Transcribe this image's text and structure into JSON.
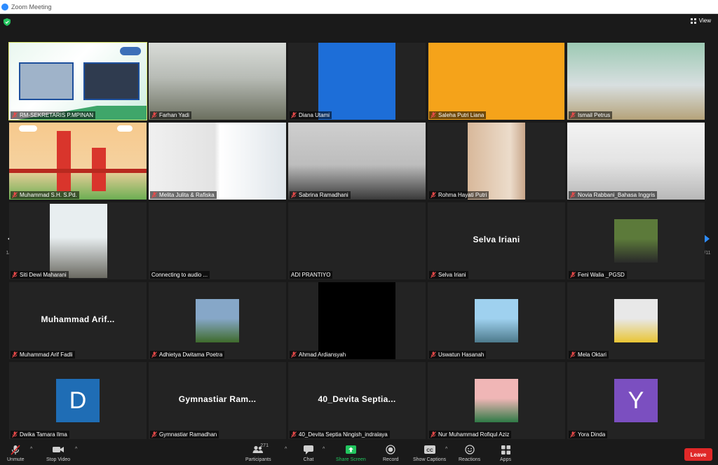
{
  "window": {
    "title": "Zoom Meeting"
  },
  "header": {
    "view_label": "View"
  },
  "pagination": {
    "left": "1/11",
    "right": "1/11"
  },
  "colors": {
    "active_speaker": "#d7e36a",
    "leave": "#e02828",
    "share": "#22c55e",
    "arrow": "#2d8cff"
  },
  "participants": [
    {
      "name": "RM-SEKRETARIS P.MPINAN",
      "display": "video",
      "icon": "shared-screen"
    },
    {
      "name": "Farhan Yadi",
      "display": "video"
    },
    {
      "name": "Diana Utami",
      "display": "video"
    },
    {
      "name": "Saleha Putri Liana",
      "display": "video"
    },
    {
      "name": "Ismail Petrus",
      "display": "video"
    },
    {
      "name": "Muhammad S.H. S.Pd.",
      "display": "video",
      "icon": "bridge-illustration"
    },
    {
      "name": "Melita Julita & Rafiska",
      "display": "video"
    },
    {
      "name": "Sabrina Ramadhani",
      "display": "video"
    },
    {
      "name": "Rohma Hayati Putri",
      "display": "video"
    },
    {
      "name": "Novia Rabbani_Bahasa Inggris",
      "display": "video"
    },
    {
      "name": "Siti Dewi Maharani",
      "display": "photo"
    },
    {
      "name": "Connecting to audio ...",
      "display": "blank"
    },
    {
      "name": "ADI PRANTIYO",
      "display": "blank"
    },
    {
      "name": "Selva Iriani",
      "display": "name",
      "big": "Selva Iriani"
    },
    {
      "name": "Feni Walia _PGSD",
      "display": "photo"
    },
    {
      "name": "Muhammad Arif Fadli",
      "display": "name",
      "big": "Muhammad  Arif..."
    },
    {
      "name": "Adhietya Dwitama Poetra",
      "display": "photo"
    },
    {
      "name": "Ahmad Ardiansyah",
      "display": "black"
    },
    {
      "name": "Uswatun Hasanah",
      "display": "photo"
    },
    {
      "name": "Mela Oktari",
      "display": "photo"
    },
    {
      "name": "Dwika Tamara Ilma",
      "display": "letter",
      "letter": "D",
      "color": "#1f6db5"
    },
    {
      "name": "Gymnastiar Ramadhan",
      "display": "name",
      "big": "Gymnastiar  Ram..."
    },
    {
      "name": "40_Devita Septia Ningish_indralaya",
      "display": "name",
      "big": "40_Devita  Septia..."
    },
    {
      "name": "Nur Muhammad Rofiqul Aziz",
      "display": "photo"
    },
    {
      "name": "Yora Dinda",
      "display": "letter",
      "letter": "Y",
      "color": "#7b4fc0"
    }
  ],
  "toolbar": {
    "unmute": "Unmute",
    "stop_video": "Stop Video",
    "participants": "Participants",
    "participants_count": "271",
    "chat": "Chat",
    "share_screen": "Share Screen",
    "record": "Record",
    "show_captions": "Show Captions",
    "reactions": "Reactions",
    "apps": "Apps",
    "leave": "Leave"
  }
}
